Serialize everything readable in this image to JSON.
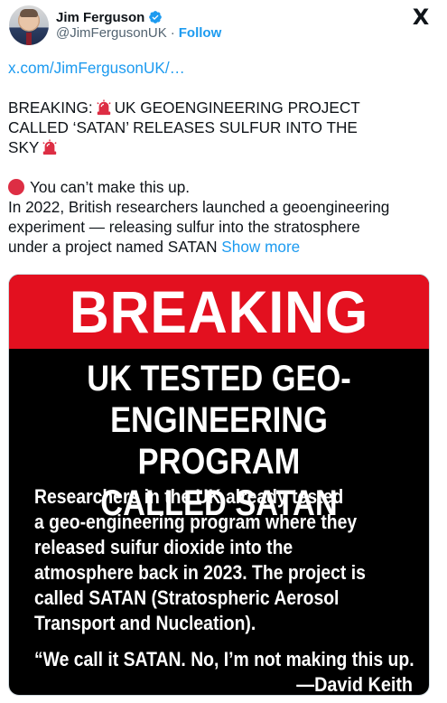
{
  "author": {
    "name": "Jim Ferguson",
    "handle": "@JimFergusonUK",
    "separator": "·",
    "follow_label": "Follow",
    "verified_icon": "verified-badge-icon"
  },
  "brand": {
    "logo": "X",
    "accent_color": "#1d9bf0"
  },
  "tweet": {
    "link_text": "x.com/JimFergusonUK/…",
    "breaking_prefix": "BREAKING:",
    "breaking_line_a": "UK GEOENGINEERING PROJECT",
    "breaking_line_b": "CALLED ‘SATAN’ RELEASES SULFUR INTO THE",
    "breaking_line_c": "SKY",
    "cant_make_up": "You can’t make this up.",
    "para_line_1": "In 2022, British researchers launched a geoengineering",
    "para_line_2": "experiment — releasing sulfur into the stratosphere",
    "para_line_3": "under a project named SATAN",
    "show_more_label": "Show more",
    "siren_icon": "rotating-light-icon",
    "red_circle_icon": "red-circle-icon"
  },
  "media": {
    "banner": "BREAKING",
    "headline": [
      "UK TESTED GEO-",
      "ENGINEERING PROGRAM",
      "CALLED SATAN"
    ],
    "body": [
      "Researchers in the UK already tested",
      "a geo-engineering program where they",
      "released suifur dioxide into the",
      "atmosphere back in 2023. The project is",
      "called SATAN (Stratospheric Aerosol",
      "Transport and Nucleation)."
    ],
    "quote": "“We call it SATAN. No, I’m not making this up.",
    "attribution": "—David Keith",
    "banner_color": "#e3101f"
  }
}
